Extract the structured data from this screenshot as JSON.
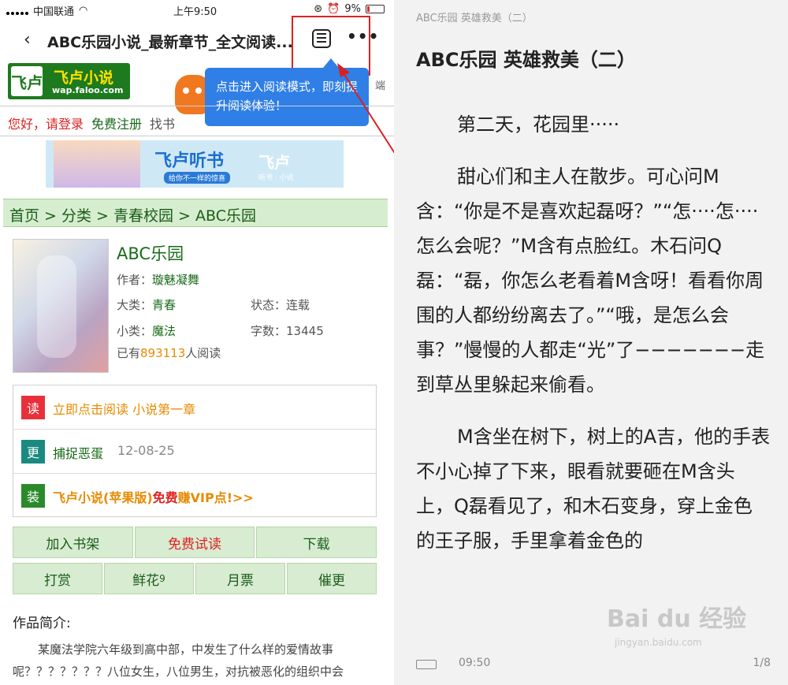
{
  "status": {
    "carrier": "中国联通",
    "time": "上午9:50",
    "battery": "9%"
  },
  "nav": {
    "back": "‹",
    "title": "ABC乐园小说_最新章节_全文阅读...",
    "more": "•••"
  },
  "logo": {
    "mark": "飞卢",
    "name": "飞卢小说",
    "url": "wap.faloo.com"
  },
  "tooltip": {
    "text": "点击进入阅读模式，即刻提升阅读体验！"
  },
  "fragment": "端",
  "greet": {
    "hello": "您好，请登录",
    "register": "免费注册",
    "find": "找书"
  },
  "banner": {
    "title": "飞卢听书",
    "tag": "给你不一样的惊喜",
    "brand": "飞卢",
    "brand_sub": "听书 · 小说"
  },
  "breadcrumb": "首页 > 分类 > 青春校园 > ABC乐园",
  "book": {
    "title": "ABC乐园",
    "author_label": "作者：",
    "author": "璇魅凝舞",
    "cat_label": "大类：",
    "cat": "青春",
    "status_label": "状态：",
    "status": "连载",
    "subcat_label": "小类：",
    "subcat": "魔法",
    "words_label": "字数：",
    "words": "13445",
    "reads_prefix": "已有",
    "reads": "893113",
    "reads_suffix": "人阅读"
  },
  "actions": [
    {
      "badge": "读",
      "text": "立即点击阅读 小说第一章",
      "color": "#e8303a",
      "date": ""
    },
    {
      "badge": "更",
      "text": "捕捉恶蛋",
      "color": "#1a8a80",
      "date": "12-08-25"
    },
    {
      "badge": "装",
      "text_a": "飞卢小说(苹果版)",
      "text_b": "免费",
      "text_c": "赚VIP点!>>",
      "color": "#2a8a2a"
    }
  ],
  "buttons1": [
    "加入书架",
    "免费试读",
    "下载"
  ],
  "buttons2": [
    "打赏",
    "鲜花",
    "月票",
    "催更"
  ],
  "flower_count": "9",
  "intro_heading": "作品简介:",
  "intro_text": "某魔法学院六年级到高中部，中发生了什么样的爱情故事呢？？？？？？？八位女生，八位男生，对抗被恶化的组织中会",
  "reader": {
    "header": "ABC乐园 英雄救美（二）",
    "title": "ABC乐园 英雄救美（二）",
    "paragraphs": [
      "第二天，花园里·····",
      "甜心们和主人在散步。可心问M含：“你是不是喜欢起磊呀？”“怎····怎····怎么会呢？”M含有点脸红。木石问Q磊：“磊，你怎么老看着M含呀！看看你周围的人都纷纷离去了。”“哦，是怎么会事？”慢慢的人都走“光”了−−−−−−−走到草丛里躲起来偷看。",
      "M含坐在树下，树上的A吉，他的手表不小心掉了下来，眼看就要砸在M含头上，Q磊看见了，和木石变身，穿上金色的王子服，手里拿着金色的"
    ],
    "time": "09:50",
    "page": "1/8"
  },
  "watermark": {
    "main": "Bai du 经验",
    "url": "jingyan.baidu.com"
  }
}
